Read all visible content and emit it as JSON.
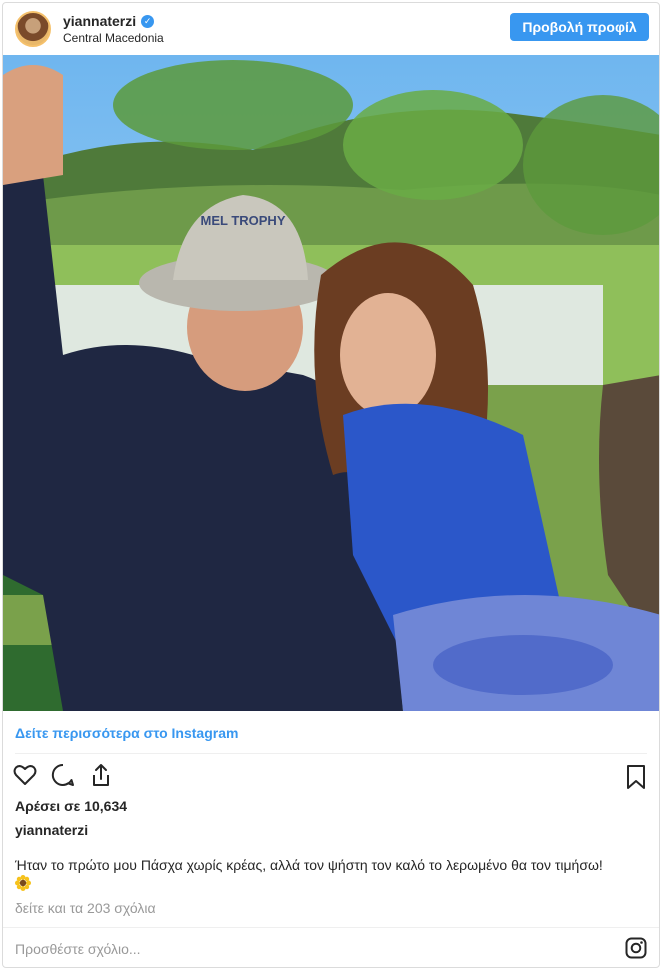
{
  "header": {
    "username": "yiannaterzi",
    "verified_mark": "✓",
    "location": "Central Macedonia",
    "profile_button": "Προβολή προφίλ"
  },
  "photo": {
    "hat_text": "MEL TROPHY"
  },
  "see_more_link": "Δείτε περισσότερα στο Instagram",
  "actions": {
    "icons": [
      "heart-icon",
      "comment-icon",
      "share-icon",
      "bookmark-icon"
    ]
  },
  "likes": "Αρέσει σε 10,634",
  "author": "yiannaterzi",
  "caption": "Ήταν το πρώτο μου Πάσχα χωρίς κρέας, αλλά τον ψήστη τον καλό το λερωμένο θα τον τιμήσω!",
  "caption_emoji": "sunflower-icon",
  "comments_link": "δείτε και τα 203 σχόλια",
  "comment_placeholder": "Προσθέστε σχόλιο...",
  "colors": {
    "accent": "#3897f0",
    "text": "#262626",
    "muted": "#999999",
    "border": "#dbdbdb"
  }
}
